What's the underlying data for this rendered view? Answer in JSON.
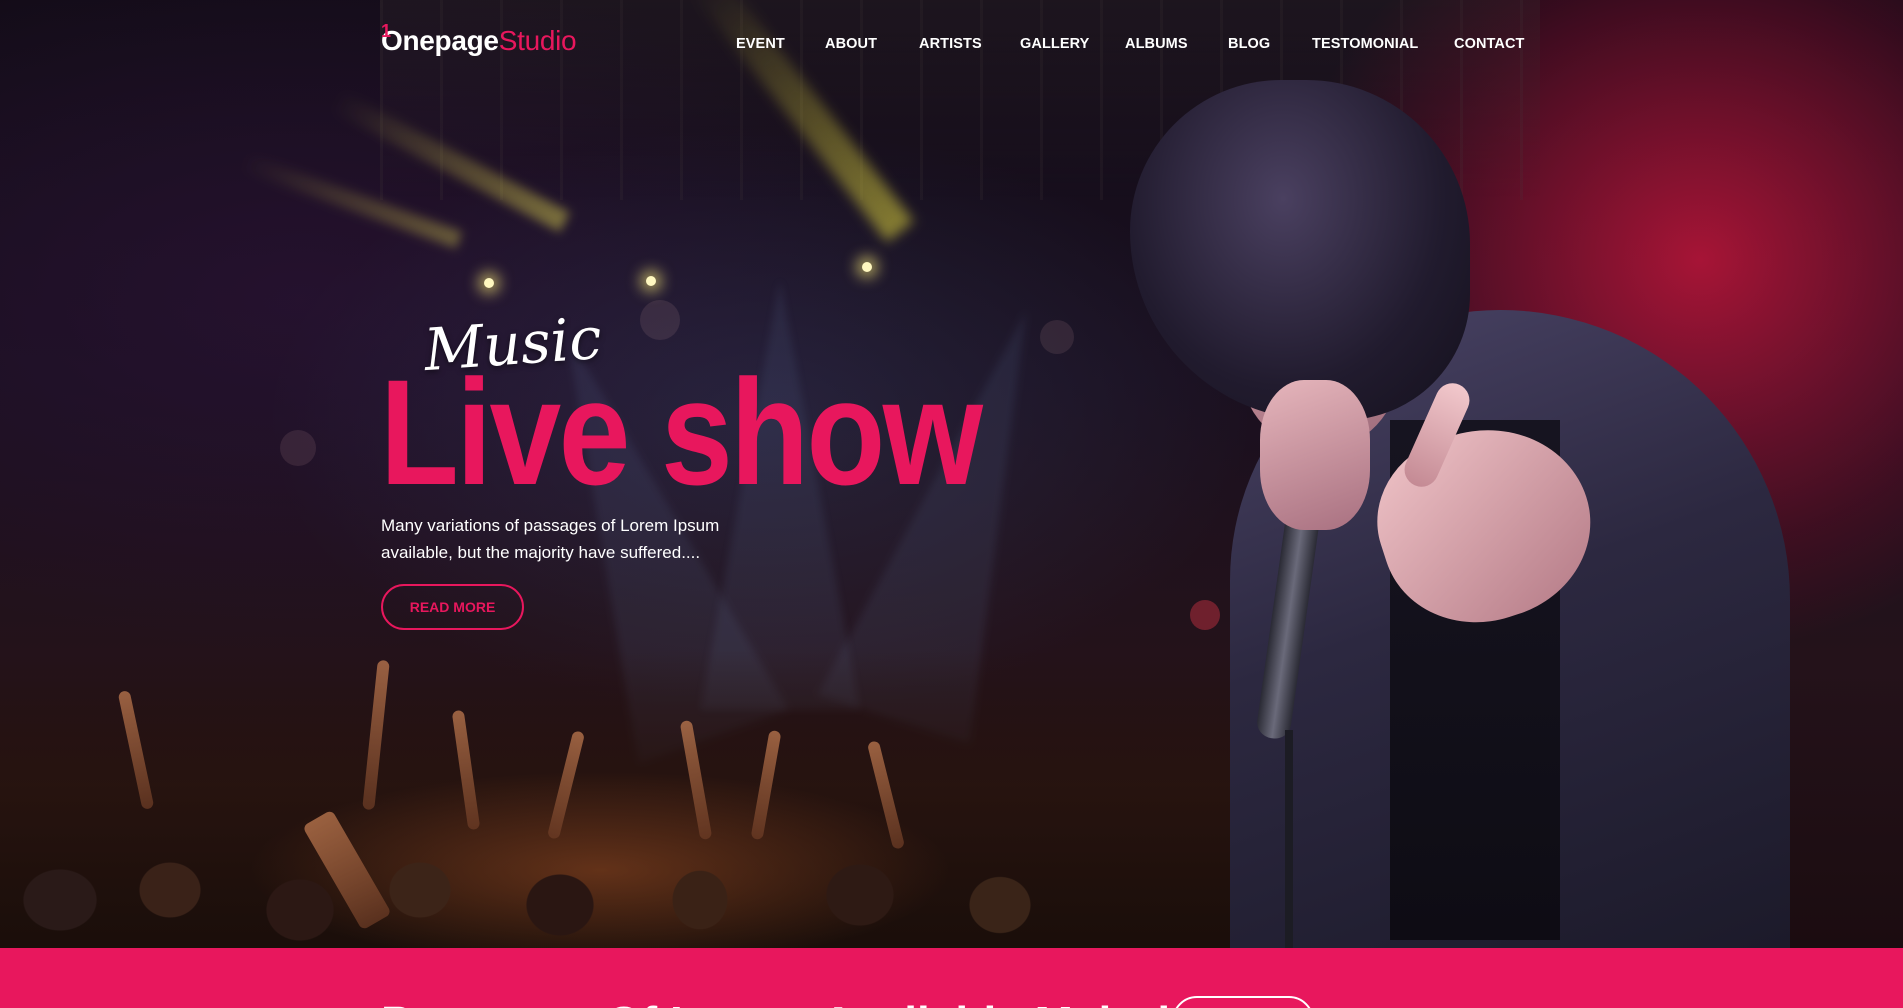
{
  "brand": {
    "logo_mark": "1",
    "logo_part1": "Onepage",
    "logo_part2": "Studio",
    "accent_color": "#e8175d"
  },
  "nav": {
    "items": [
      {
        "label": "EVENT"
      },
      {
        "label": "ABOUT"
      },
      {
        "label": "ARTISTS"
      },
      {
        "label": "GALLERY"
      },
      {
        "label": "ALBUMS"
      },
      {
        "label": "BLOG"
      },
      {
        "label": "TESTOMONIAL"
      },
      {
        "label": "CONTACT"
      }
    ]
  },
  "hero": {
    "kicker": "Music",
    "headline": "Live show",
    "lead": "Many variations of passages of Lorem Ipsum available, but the majority have suffered....",
    "cta_label": "READ MORE",
    "image": "concert-singer-photo"
  },
  "band": {
    "heading": "Passages Of Lorem Available Majority",
    "button_label": ""
  }
}
